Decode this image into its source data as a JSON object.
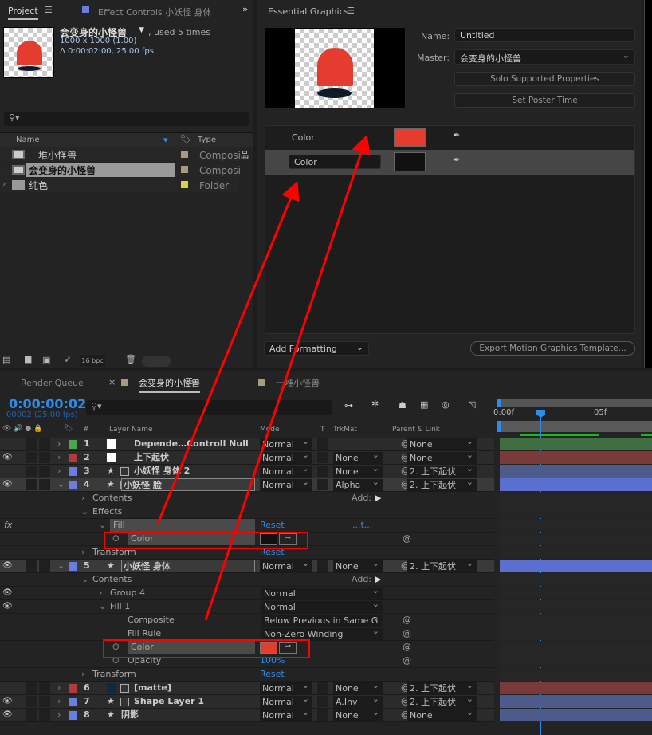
{
  "project": {
    "tab_label": "Project",
    "effect_controls_tab": "Effect Controls 小妖怪 身体",
    "comp_name": "会变身的小怪兽",
    "used": ", used 5 times",
    "dimensions": "1000 x 1000 (1.00)",
    "duration": "Δ 0:00:02:00, 25.00 fps",
    "columns": {
      "name": "Name",
      "type": "Type"
    },
    "items": [
      {
        "name": "一堆小怪兽",
        "type": "Composi",
        "label_color": "#a89a7c",
        "icon": "composition-icon",
        "selected": false
      },
      {
        "name": "会变身的小怪兽",
        "type": "Composi",
        "label_color": "#a89a7c",
        "icon": "composition-icon",
        "selected": true
      },
      {
        "name": "纯色",
        "type": "Folder",
        "label_color": "#e0d040",
        "icon": "folder-icon",
        "selected": false
      }
    ],
    "bpc": "16 bpc"
  },
  "essential_graphics": {
    "title": "Essential Graphics",
    "name_label": "Name:",
    "name_value": "Untitled",
    "master_label": "Master:",
    "master_value": "会变身的小怪兽",
    "solo_button": "Solo Supported Properties",
    "poster_button": "Set Poster Time",
    "properties": [
      {
        "label": "Color",
        "color": "#e43c2e",
        "editing": false
      },
      {
        "label": "Color",
        "color": "#111111",
        "editing": true
      }
    ],
    "add_formatting": "Add Formatting",
    "export_button": "Export Motion Graphics Template..."
  },
  "timeline": {
    "tabs": [
      {
        "label": "Render Queue",
        "active": false
      },
      {
        "label": "会变身的小怪兽",
        "active": true,
        "color": "#a89a7c"
      },
      {
        "label": "一堆小怪兽",
        "active": false,
        "color": "#a89a7c"
      }
    ],
    "timecode": "0:00:00:02",
    "frame_info": "00002 (25.00 fps)",
    "columns": {
      "num": "#",
      "layer_name": "Layer Name",
      "mode": "Mode",
      "t": "T",
      "trkmat": "TrkMat",
      "parent": "Parent & Link"
    },
    "ruler": [
      "0:00f",
      "05f"
    ],
    "rows": [
      {
        "kind": "layer",
        "eye": false,
        "num": "1",
        "label": "#4ca64c",
        "swatch": "#ffffff",
        "name": "Depende…Controll Null",
        "mode": "Normal",
        "trkmat": "",
        "parent": "None",
        "bar": "#3f6e40"
      },
      {
        "kind": "layer",
        "eye": true,
        "num": "2",
        "label": "#b33a3a",
        "swatch": "#ffffff",
        "name": "上下起伏",
        "mode": "Normal",
        "trkmat": "None",
        "parent": "None",
        "bar": "#7a3a3a"
      },
      {
        "kind": "layer",
        "eye": false,
        "num": "3",
        "label": "#6a7de0",
        "star": true,
        "icon": "shape",
        "name": "小妖怪 身体 2",
        "mode": "Normal",
        "trkmat": "None",
        "parent": "2. 上下起伏",
        "bar": "#4d5a8c"
      },
      {
        "kind": "layer",
        "eye": true,
        "num": "4",
        "label": "#6a7de0",
        "star": true,
        "icon": "shape",
        "name": "小妖怪 脸",
        "mode": "Normal",
        "trkmat": "Alpha",
        "parent": "2. 上下起伏",
        "bar": "#5a6fd0",
        "sel": true
      },
      {
        "kind": "prop",
        "indent": 1,
        "twirl": ">",
        "label": "Contents",
        "add": "Add:"
      },
      {
        "kind": "prop",
        "indent": 1,
        "twirl": "v",
        "label": "Effects"
      },
      {
        "kind": "prop",
        "indent": 2,
        "twirl": "v",
        "label": "Fill",
        "fx": "fx",
        "link": "Reset",
        "extra": "...t...",
        "hl": true
      },
      {
        "kind": "prop",
        "indent": 3,
        "stopwatch": true,
        "label": "Color",
        "swatch": "#111111",
        "spiral": true,
        "hl": true
      },
      {
        "kind": "prop",
        "indent": 1,
        "twirl": ">",
        "label": "Transform",
        "link": "Reset"
      },
      {
        "kind": "layer",
        "eye": true,
        "num": "5",
        "label": "#6a7de0",
        "star": true,
        "name": "小妖怪 身体",
        "mode": "Normal",
        "trkmat": "None",
        "parent": "2. 上下起伏",
        "bar": "#5a6fd0",
        "sel": true
      },
      {
        "kind": "prop",
        "indent": 1,
        "twirl": "v",
        "label": "Contents",
        "add": "Add:"
      },
      {
        "kind": "prop",
        "indent": 2,
        "eye": true,
        "twirl": ">",
        "label": "Group 4",
        "dropdown": "Normal"
      },
      {
        "kind": "prop",
        "indent": 2,
        "eye": true,
        "twirl": "v",
        "label": "Fill 1",
        "dropdown": "Normal"
      },
      {
        "kind": "prop",
        "indent": 3,
        "label": "Composite",
        "dropdown": "Below Previous in Same G",
        "spiral": true
      },
      {
        "kind": "prop",
        "indent": 3,
        "label": "Fill Rule",
        "dropdown": "Non-Zero Winding",
        "spiral": true
      },
      {
        "kind": "prop",
        "indent": 3,
        "stopwatch": true,
        "label": "Color",
        "swatch": "#e43c2e",
        "spiral": true,
        "hl": true
      },
      {
        "kind": "prop",
        "indent": 3,
        "stopwatch": true,
        "label": "Opacity",
        "link": "100%",
        "spiral": true
      },
      {
        "kind": "prop",
        "indent": 1,
        "twirl": ">",
        "label": "Transform",
        "link": "Reset"
      },
      {
        "kind": "layer",
        "eye": false,
        "num": "6",
        "label": "#b33a3a",
        "swatch": "#0d2a40",
        "icon": "shape",
        "name": "[matte]",
        "mode": "Normal",
        "trkmat": "None",
        "parent": "2. 上下起伏",
        "bar": "#7a3a3a"
      },
      {
        "kind": "layer",
        "eye": true,
        "num": "7",
        "label": "#6a7de0",
        "star": true,
        "icon": "shape",
        "name": "Shape Layer 1",
        "mode": "Normal",
        "trkmat": "A.Inv",
        "parent": "2. 上下起伏",
        "bar": "#4d5a8c"
      },
      {
        "kind": "layer",
        "eye": true,
        "num": "8",
        "label": "#6a7de0",
        "star": true,
        "name": "阴影",
        "mode": "Normal",
        "trkmat": "None",
        "parent": "None",
        "bar": "#4d5a8c"
      }
    ]
  },
  "colors": {
    "accent": "#2d8ceb",
    "annotation": "#ff0000",
    "monster_red": "#e43c2e"
  }
}
